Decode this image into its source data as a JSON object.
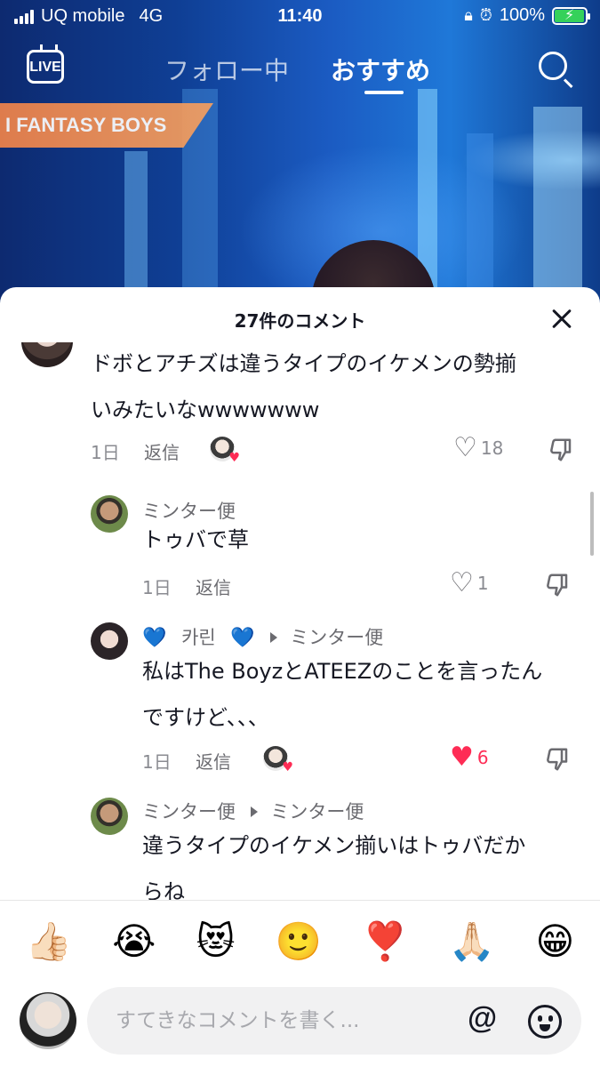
{
  "status_bar": {
    "carrier": "UQ mobile",
    "network": "4G",
    "time": "11:40",
    "battery": "100%"
  },
  "top_nav": {
    "live_label": "LIVE",
    "tabs": [
      {
        "label": "フォロー中",
        "active": false
      },
      {
        "label": "おすすめ",
        "active": true
      }
    ]
  },
  "video": {
    "caption": "I FANTASY BOYS"
  },
  "comments_sheet": {
    "title": "27件のコメント",
    "comments": [
      {
        "text_line1": "ドボとアチズは違うタイプのイケメンの勢揃",
        "text_line2": "いみたいなwwwwwww",
        "time": "1日",
        "reply": "返信",
        "likes": "18",
        "liked": false,
        "author_liked": true
      },
      {
        "author": "ミンター便",
        "text": "トゥバで草",
        "time": "1日",
        "reply": "返信",
        "likes": "1",
        "liked": false
      },
      {
        "author_prefix": "💙",
        "author": "카린",
        "author_suffix": "💙",
        "reply_to": "ミンター便",
        "text_line1": "私はThe BoyzとATEEZのことを言ったん",
        "text_line2": "ですけど、、、",
        "time": "1日",
        "reply": "返信",
        "likes": "6",
        "liked": true,
        "author_liked": true
      },
      {
        "author": "ミンター便",
        "reply_to": "ミンター便",
        "text_line1": "違うタイプのイケメン揃いはトゥバだか",
        "text_line2": "らね"
      }
    ]
  },
  "emoji_bar": [
    "👍🏻",
    "😭",
    "😻",
    "🙂",
    "❣️",
    "🙏🏻",
    "😁"
  ],
  "composer": {
    "placeholder": "すてきなコメントを書く..."
  }
}
